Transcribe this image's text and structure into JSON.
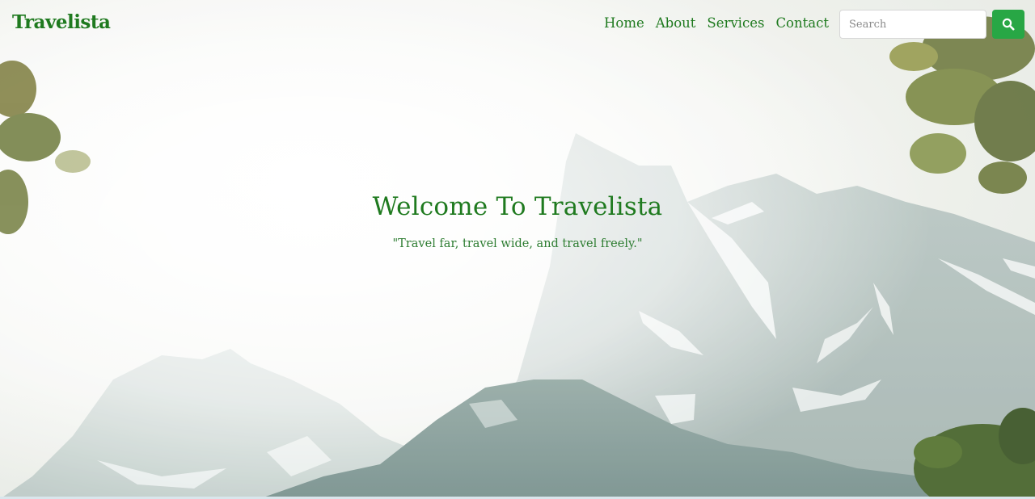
{
  "navbar": {
    "brand": "Travelista",
    "links": [
      {
        "label": "Home"
      },
      {
        "label": "About"
      },
      {
        "label": "Services"
      },
      {
        "label": "Contact"
      }
    ],
    "search": {
      "placeholder": "Search",
      "button_icon": "search-icon"
    }
  },
  "hero": {
    "title": "Welcome To Travelista",
    "tagline": "\"Travel far, travel wide, and travel freely.\""
  },
  "colors": {
    "brand_green": "#1f7a1f",
    "button_green": "#28a745"
  }
}
